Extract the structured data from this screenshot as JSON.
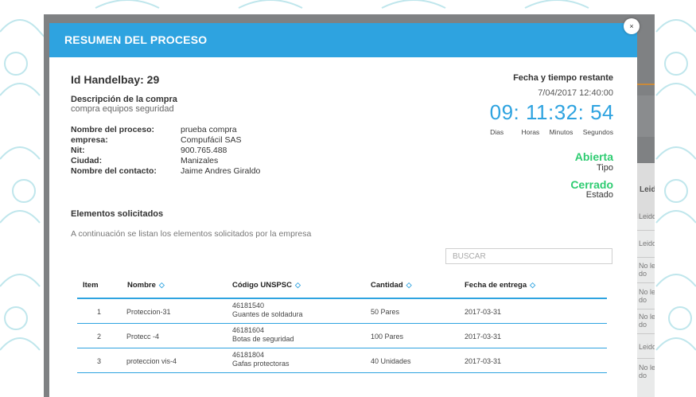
{
  "modal": {
    "title": "RESUMEN DEL PROCESO",
    "close_icon": "×",
    "id_label": "Id Handelbay: 29",
    "description_label": "Descripción de la compra",
    "description_value": "compra equipos seguridad",
    "info": [
      {
        "key": "Nombre del proceso:",
        "value": "prueba compra"
      },
      {
        "key": "empresa:",
        "value": "Compufácil SAS"
      },
      {
        "key": "Nit:",
        "value": "900.765.488"
      },
      {
        "key": "Ciudad:",
        "value": "Manizales"
      },
      {
        "key": "Nombre del contacto:",
        "value": "Jaime Andres Giraldo"
      }
    ],
    "deadline": {
      "title": "Fecha y tiempo restante",
      "date": "7/04/2017 12:40:00",
      "countdown": "09: 11:32: 54",
      "labels": [
        "Dias",
        "Horas",
        "Minutos",
        "Segundos"
      ]
    },
    "status": [
      {
        "value": "Abierta",
        "label": "Tipo"
      },
      {
        "value": "Cerrado",
        "label": "Estado"
      }
    ],
    "elements_title": "Elementos solicitados",
    "elements_description": "A continuación se listan los elementos solicitados por la empresa",
    "search": {
      "placeholder": "BUSCAR"
    },
    "table": {
      "headers": [
        "Item",
        "Nombre",
        "Código UNSPSC",
        "Cantidad",
        "Fecha de entrega"
      ],
      "sort_icon": "◇",
      "rows": [
        {
          "item": "1",
          "nombre": "Proteccion-31",
          "codigo": "46181540",
          "codigo_desc": "Guantes de soldadura",
          "cantidad": "50 Pares",
          "fecha": "2017-03-31"
        },
        {
          "item": "2",
          "nombre": "Protecc -4",
          "codigo": "46181604",
          "codigo_desc": "Botas de seguridad",
          "cantidad": "100 Pares",
          "fecha": "2017-03-31"
        },
        {
          "item": "3",
          "nombre": "proteccion vis-4",
          "codigo": "46181804",
          "codigo_desc": "Gafas protectoras",
          "cantidad": "40 Unidades",
          "fecha": "2017-03-31"
        }
      ]
    }
  },
  "background_table": {
    "header": "Leid",
    "cells": [
      "Leido",
      "Leido",
      "No leido",
      "No leido",
      "No leido",
      "Leido",
      "No leido"
    ]
  },
  "colors": {
    "accent": "#2ea3e0",
    "status_green": "#2ecc71"
  }
}
